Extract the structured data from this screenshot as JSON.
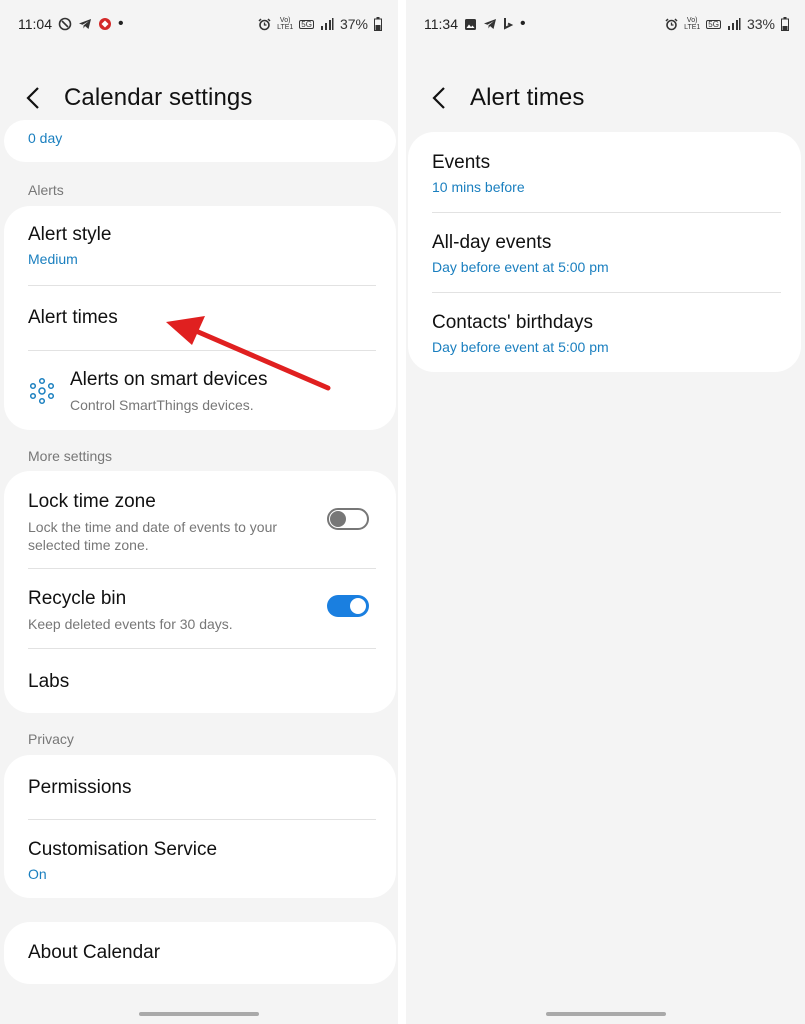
{
  "left": {
    "status": {
      "time": "11:04",
      "battery": "37%",
      "net_top": "Vo)",
      "net_bottom": "LTE1",
      "gen": "5G"
    },
    "header": {
      "title": "Calendar settings"
    },
    "top_partial": {
      "value": "0 day"
    },
    "sections": {
      "alerts": "Alerts",
      "more": "More settings",
      "privacy": "Privacy"
    },
    "alerts": {
      "alert_style": {
        "label": "Alert style",
        "value": "Medium"
      },
      "alert_times": {
        "label": "Alert times"
      },
      "smart_devices": {
        "label": "Alerts on smart devices",
        "desc": "Control SmartThings devices."
      }
    },
    "more": {
      "lock_tz": {
        "label": "Lock time zone",
        "desc_line1": "Lock the time and date of events to your",
        "desc_line2": "selected time zone.",
        "enabled": false
      },
      "recycle": {
        "label": "Recycle bin",
        "desc": "Keep deleted events for 30 days.",
        "enabled": true
      },
      "labs": {
        "label": "Labs"
      }
    },
    "privacy": {
      "permissions": {
        "label": "Permissions"
      },
      "customisation": {
        "label": "Customisation Service",
        "value": "On"
      }
    },
    "about": {
      "label": "About Calendar"
    }
  },
  "right": {
    "status": {
      "time": "11:34",
      "battery": "33%",
      "net_top": "Vo)",
      "net_bottom": "LTE1",
      "gen": "5G"
    },
    "header": {
      "title": "Alert times"
    },
    "items": [
      {
        "label": "Events",
        "value": "10 mins before"
      },
      {
        "label": "All-day events",
        "value": "Day before event at 5:00 pm"
      },
      {
        "label": "Contacts' birthdays",
        "value": "Day before event at 5:00 pm"
      }
    ]
  },
  "colors": {
    "accent": "#1a7fbf",
    "toggle_on": "#1a7fe0",
    "arrow": "#e02020",
    "background": "#f4f4f4"
  }
}
